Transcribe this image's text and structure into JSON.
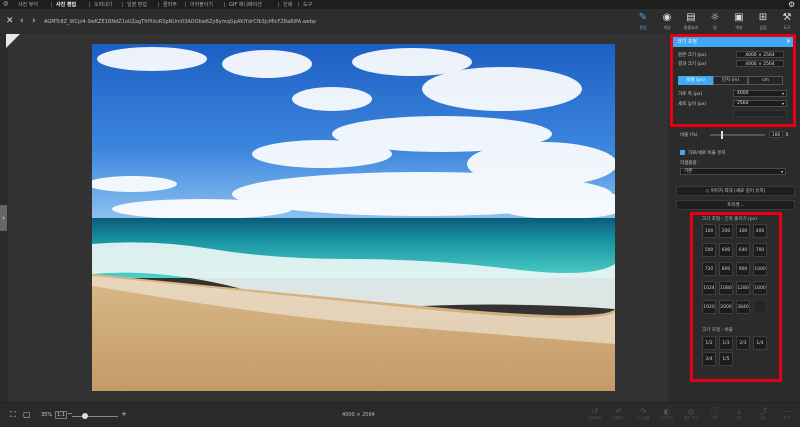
{
  "menu": {
    "tabs": [
      {
        "label": "사진 뷰어"
      },
      {
        "label": "사진 편집"
      },
      {
        "label": "오려내기"
      },
      {
        "label": "일괄 편집"
      },
      {
        "label": "콜라주"
      },
      {
        "label": "이어붙이기"
      },
      {
        "label": "GIF 애니메이션"
      },
      {
        "label": "인쇄"
      },
      {
        "label": "도구"
      }
    ],
    "active_tab": "사진 편집"
  },
  "toolbar": {
    "filename": "AGMTc8Z_WCpl4-9wKZE1RNdZ1oUZagTfrPIduRSpNUm03AOObw6ZyBymqGpAKlYdrCfb3jcMIcFZRaRiPA.webp",
    "tools": [
      {
        "label": "편집",
        "icon": "edit-icon"
      },
      {
        "label": "색상",
        "icon": "circle-icon"
      },
      {
        "label": "필름효과",
        "icon": "film-icon"
      },
      {
        "label": "빛",
        "icon": "light-icon"
      },
      {
        "label": "액자",
        "icon": "frame-icon"
      },
      {
        "label": "삽입",
        "icon": "insert-icon"
      },
      {
        "label": "도구",
        "icon": "tools-icon"
      }
    ]
  },
  "status": {
    "image_size": "4000 × 2564",
    "zoom_percent": "35%",
    "zoom_slider_fraction": 0.2
  },
  "bottom_tools": [
    {
      "label": "원래대로"
    },
    {
      "label": "실행취소"
    },
    {
      "label": "다시실행"
    },
    {
      "label": "비교하기"
    },
    {
      "label": "원본 보기"
    },
    {
      "label": "정보"
    },
    {
      "label": "저장"
    },
    {
      "label": "공유"
    },
    {
      "label": "도구"
    }
  ],
  "resize_panel": {
    "title": "크기 조정",
    "original_size_label": "원본 크기 (px)",
    "original_size_value": "4000 × 2564",
    "result_size_label": "결과 크기 (px)",
    "result_size_value": "4000 × 2564",
    "units": [
      {
        "label": "픽셀 (px)",
        "active": true
      },
      {
        "label": "인치 (in)",
        "active": false
      },
      {
        "label": "cm",
        "active": false
      }
    ],
    "width_label": "가로 폭 (px)",
    "width_value": "4000",
    "height_label": "세로 높이 (px)",
    "height_value": "2564",
    "ratio_label": "비율 (%)",
    "ratio_value": "100",
    "keep_ratio_label": "가로/세로 비율 유지",
    "keep_ratio_checked": true,
    "resample_label": "리샘플링:",
    "resample_value": "기본",
    "fit_button_label": "이미지 최대 (세로 길이 유지)",
    "more_button_label": "프리셋...",
    "preset_long_title": "크기 조절 - 긴쪽 줄이기 (px)",
    "preset_long_values": [
      "100",
      "200",
      "300",
      "400",
      "500",
      "600",
      "640",
      "700",
      "720",
      "800",
      "900",
      "1000",
      "1024",
      "1080",
      "1280",
      "1600",
      "1920",
      "2000",
      "3840",
      ""
    ],
    "preset_ratio_title": "크기 조절 - 비율",
    "preset_ratio_values": [
      "1/2",
      "1/3",
      "2/3",
      "1/4",
      "3/4",
      "1/5"
    ]
  },
  "colors": {
    "accent": "#3fa9f5",
    "highlight_box": "#e60012"
  }
}
